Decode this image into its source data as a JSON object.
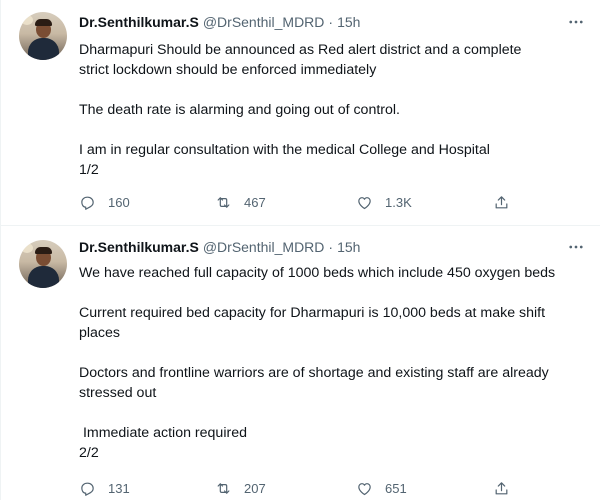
{
  "tweets": [
    {
      "name": "Dr.Senthilkumar.S",
      "handle": "@DrSenthil_MDRD",
      "separator": "·",
      "time": "15h",
      "lines": [
        "Dharmapuri  Should be announced as Red alert  district and a complete",
        "strict lockdown should be enforced immediately",
        "",
        "The death rate is alarming and going out of control.",
        "",
        "I am in regular consultation  with the medical College and  Hospital",
        "1/2"
      ],
      "replies": "160",
      "retweets": "467",
      "likes": "1.3K"
    },
    {
      "name": "Dr.Senthilkumar.S",
      "handle": "@DrSenthil_MDRD",
      "separator": "·",
      "time": "15h",
      "lines": [
        "We have reached full capacity of 1000 beds which include 450 oxygen beds",
        "",
        "Current required bed capacity for Dharmapuri is 10,000 beds at make shift",
        "places",
        "",
        "Doctors and frontline warriors are of shortage and existing staff are already",
        "stressed out",
        "",
        " Immediate action required",
        "2/2"
      ],
      "replies": "131",
      "retweets": "207",
      "likes": "651"
    }
  ],
  "icons": {
    "more": "more-options-icon",
    "reply": "reply-icon",
    "retweet": "retweet-icon",
    "like": "heart-icon",
    "share": "share-icon"
  },
  "colors": {
    "text": "#0f1419",
    "secondary": "#536471",
    "divider": "#eff3f4"
  }
}
